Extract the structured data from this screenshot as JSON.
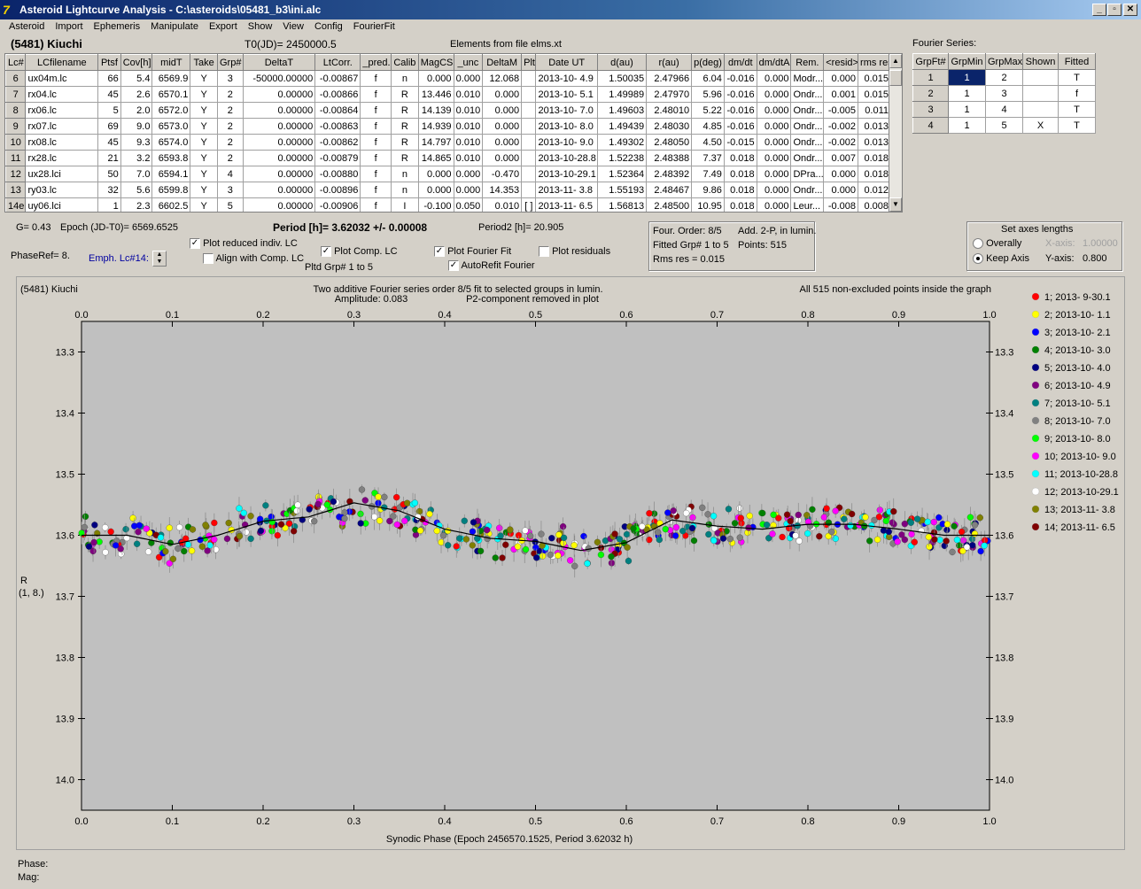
{
  "window": {
    "title": "Asteroid Lightcurve Analysis - C:\\asteroids\\05481_b3\\ini.alc",
    "icon_glyph": "7",
    "buttons": {
      "minimize": "_",
      "restore": "▫",
      "close": "✕"
    }
  },
  "menu": [
    "Asteroid",
    "Import",
    "Ephemeris",
    "Manipulate",
    "Export",
    "Show",
    "View",
    "Config",
    "FourierFit"
  ],
  "header": {
    "object": "(5481) Kiuchi",
    "t0": "T0(JD)= 2450000.5",
    "elements": "Elements from file elms.xt"
  },
  "lc_table": {
    "columns": [
      "Lc#",
      "LCfilename",
      "Ptsf",
      "Cov[h]",
      "midT",
      "Take",
      "Grp#",
      "DeltaT",
      "LtCorr.",
      "_pred.",
      "Calib",
      "MagCS",
      "_unc",
      "DeltaM",
      "Plt",
      "Date UT",
      "d(au)",
      "r(au)",
      "p(deg)",
      "dm/dt",
      "dm/dtA",
      "Rem.",
      "<resid>",
      "rms res"
    ],
    "rows": [
      [
        "6",
        "ux04m.lc",
        "66",
        "5.4",
        "6569.9",
        "Y",
        "3",
        "-50000.00000",
        "-0.00867",
        "f",
        "n",
        "0.000",
        "0.000",
        "12.068",
        "",
        "2013-10- 4.9",
        "1.50035",
        "2.47966",
        "6.04",
        "-0.016",
        "0.000",
        "Modr...",
        "0.000",
        "0.015"
      ],
      [
        "7",
        "rx04.lc",
        "45",
        "2.6",
        "6570.1",
        "Y",
        "2",
        "0.00000",
        "-0.00866",
        "f",
        "R",
        "13.446",
        "0.010",
        "0.000",
        "",
        "2013-10- 5.1",
        "1.49989",
        "2.47970",
        "5.96",
        "-0.016",
        "0.000",
        "Ondr...",
        "0.001",
        "0.015"
      ],
      [
        "8",
        "rx06.lc",
        "5",
        "2.0",
        "6572.0",
        "Y",
        "2",
        "0.00000",
        "-0.00864",
        "f",
        "R",
        "14.139",
        "0.010",
        "0.000",
        "",
        "2013-10- 7.0",
        "1.49603",
        "2.48010",
        "5.22",
        "-0.016",
        "0.000",
        "Ondr...",
        "-0.005",
        "0.011"
      ],
      [
        "9",
        "rx07.lc",
        "69",
        "9.0",
        "6573.0",
        "Y",
        "2",
        "0.00000",
        "-0.00863",
        "f",
        "R",
        "14.939",
        "0.010",
        "0.000",
        "",
        "2013-10- 8.0",
        "1.49439",
        "2.48030",
        "4.85",
        "-0.016",
        "0.000",
        "Ondr...",
        "-0.002",
        "0.013"
      ],
      [
        "10",
        "rx08.lc",
        "45",
        "9.3",
        "6574.0",
        "Y",
        "2",
        "0.00000",
        "-0.00862",
        "f",
        "R",
        "14.797",
        "0.010",
        "0.000",
        "",
        "2013-10- 9.0",
        "1.49302",
        "2.48050",
        "4.50",
        "-0.015",
        "0.000",
        "Ondr...",
        "-0.002",
        "0.013"
      ],
      [
        "11",
        "rx28.lc",
        "21",
        "3.2",
        "6593.8",
        "Y",
        "2",
        "0.00000",
        "-0.00879",
        "f",
        "R",
        "14.865",
        "0.010",
        "0.000",
        "",
        "2013-10-28.8",
        "1.52238",
        "2.48388",
        "7.37",
        "0.018",
        "0.000",
        "Ondr...",
        "0.007",
        "0.018"
      ],
      [
        "12",
        "ux28.lci",
        "50",
        "7.0",
        "6594.1",
        "Y",
        "4",
        "0.00000",
        "-0.00880",
        "f",
        "n",
        "0.000",
        "0.000",
        "-0.470",
        "",
        "2013-10-29.1",
        "1.52364",
        "2.48392",
        "7.49",
        "0.018",
        "0.000",
        "DPra...",
        "0.000",
        "0.018"
      ],
      [
        "13",
        "ry03.lc",
        "32",
        "5.6",
        "6599.8",
        "Y",
        "3",
        "0.00000",
        "-0.00896",
        "f",
        "n",
        "0.000",
        "0.000",
        "14.353",
        "",
        "2013-11- 3.8",
        "1.55193",
        "2.48467",
        "9.86",
        "0.018",
        "0.000",
        "Ondr...",
        "0.000",
        "0.012"
      ],
      [
        "14e",
        "uy06.lci",
        "1",
        "2.3",
        "6602.5",
        "Y",
        "5",
        "0.00000",
        "-0.00906",
        "f",
        "I",
        "-0.100",
        "0.050",
        "0.010",
        "[ ]",
        "2013-11- 6.5",
        "1.56813",
        "2.48500",
        "10.95",
        "0.018",
        "0.000",
        "Leur...",
        "-0.008",
        "0.008"
      ]
    ],
    "scroll_up": "▲",
    "scroll_down": "▼"
  },
  "fourier_series": {
    "label": "Fourier Series:",
    "columns": [
      "GrpFt#",
      "GrpMin",
      "GrpMax",
      "Shown",
      "Fitted"
    ],
    "rows": [
      [
        "1",
        "1",
        "2",
        "",
        "T"
      ],
      [
        "2",
        "1",
        "3",
        "",
        "f"
      ],
      [
        "3",
        "1",
        "4",
        "",
        "T"
      ],
      [
        "4",
        "1",
        "5",
        "X",
        "T"
      ]
    ]
  },
  "info": {
    "g": "G= 0.43",
    "epoch": "Epoch (JD-T0)= 6569.6525",
    "period": "Period [h]= 3.62032 +/- 0.00008",
    "period2": "Period2 [h]= 20.905",
    "phaseref": "PhaseRef= 8.",
    "emph": "Emph. Lc#14:",
    "pltd_grp": "Pltd Grp#  1   to   5"
  },
  "checkboxes": [
    {
      "label": "Plot reduced indiv. LC",
      "checked": true
    },
    {
      "label": "Align with Comp. LC",
      "checked": false
    },
    {
      "label": "Plot Comp. LC",
      "checked": true
    },
    {
      "label": "Plot Fourier Fit",
      "checked": true
    },
    {
      "label": "AutoRefit Fourier",
      "checked": true
    },
    {
      "label": "Plot residuals",
      "checked": false
    }
  ],
  "fit_info": {
    "order": "Four. Order:  8/5",
    "add": "Add. 2-P, in lumin.",
    "fitted": "Fitted Grp# 1 to 5",
    "points": "Points: 515",
    "rms": "Rms res     = 0.015"
  },
  "axes_box": {
    "title": "Set axes lengths",
    "overall": "Overally",
    "keep": "Keep Axis",
    "xaxis_label": "X-axis:",
    "xaxis_value": "1.00000",
    "yaxis_label": "Y-axis:",
    "yaxis_value": "0.800",
    "selected": "keep"
  },
  "plot": {
    "name": "(5481) Kiuchi",
    "title1": "Two additive Fourier series order 8/5 fit to selected groups in lumin.",
    "title2": "Amplitude: 0.083",
    "title3": "P2-component removed in plot",
    "right_note": "All 515 non-excluded points inside the graph",
    "xlabel": "Synodic Phase (Epoch 2456570.1525, Period 3.62032 h)",
    "ylabel1": "R",
    "ylabel2": "(1, 8.)",
    "xticks": [
      "0.0",
      "0.1",
      "0.2",
      "0.3",
      "0.4",
      "0.5",
      "0.6",
      "0.7",
      "0.8",
      "0.9",
      "1.0"
    ],
    "yticks": [
      "13.3",
      "13.4",
      "13.5",
      "13.6",
      "13.7",
      "13.8",
      "13.9",
      "14.0"
    ]
  },
  "chart_data": {
    "type": "scatter",
    "xlim": [
      0.0,
      1.0
    ],
    "ylim": [
      13.3,
      14.1
    ],
    "y_inverted": true,
    "mean_mag": 13.6,
    "fit_amplitude": 0.083,
    "legend": [
      {
        "label": "1; 2013- 9-30.1",
        "color": "#ff0000"
      },
      {
        "label": "2; 2013-10- 1.1",
        "color": "#ffff00"
      },
      {
        "label": "3; 2013-10- 2.1",
        "color": "#0000ff"
      },
      {
        "label": "4; 2013-10- 3.0",
        "color": "#008000"
      },
      {
        "label": "5; 2013-10- 4.0",
        "color": "#000080"
      },
      {
        "label": "6; 2013-10- 4.9",
        "color": "#800080"
      },
      {
        "label": "7; 2013-10- 5.1",
        "color": "#008080"
      },
      {
        "label": "8; 2013-10- 7.0",
        "color": "#808080"
      },
      {
        "label": "9; 2013-10- 8.0",
        "color": "#00ff00"
      },
      {
        "label": "10; 2013-10- 9.0",
        "color": "#ff00ff"
      },
      {
        "label": "11; 2013-10-28.8",
        "color": "#00ffff"
      },
      {
        "label": "12; 2013-10-29.1",
        "color": "#ffffff"
      },
      {
        "label": "13; 2013-11- 3.8",
        "color": "#808000"
      },
      {
        "label": "14; 2013-11- 6.5",
        "color": "#800000"
      }
    ],
    "fit_curve": {
      "x": [
        0.0,
        0.05,
        0.1,
        0.15,
        0.2,
        0.25,
        0.3,
        0.35,
        0.4,
        0.45,
        0.5,
        0.55,
        0.6,
        0.65,
        0.7,
        0.75,
        0.8,
        0.85,
        0.9,
        0.95,
        1.0
      ],
      "y": [
        13.6,
        13.6,
        13.615,
        13.6,
        13.577,
        13.57,
        13.547,
        13.56,
        13.59,
        13.605,
        13.61,
        13.625,
        13.612,
        13.575,
        13.585,
        13.59,
        13.582,
        13.582,
        13.59,
        13.6,
        13.6
      ]
    }
  },
  "status": {
    "phase": "Phase:",
    "mag": "Mag:"
  }
}
